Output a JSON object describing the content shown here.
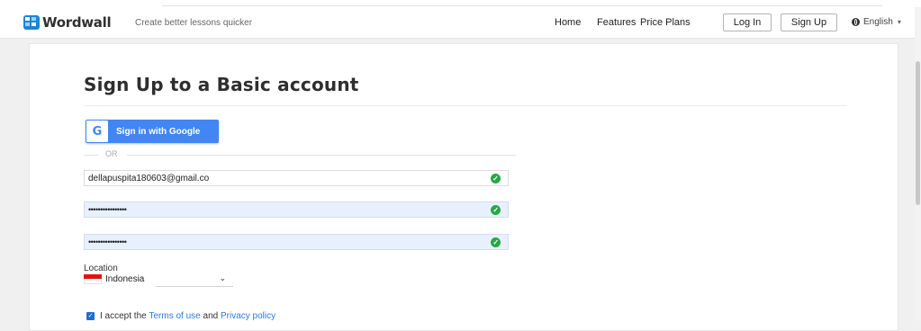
{
  "header": {
    "logo_text": "Wordwall",
    "tagline": "Create better lessons quicker",
    "nav": [
      "Home",
      "Features",
      "Price Plans"
    ],
    "login_label": "Log In",
    "signup_label": "Sign Up",
    "language": "English"
  },
  "page": {
    "title": "Sign Up to a Basic account"
  },
  "form": {
    "google_label": "Sign in with Google",
    "google_letter": "G",
    "or_label": "OR",
    "email_value": "dellapuspita180603@gmail.co",
    "password_value": "••••••••••••••••",
    "confirm_value": "••••••••••••••••",
    "location_label": "Location",
    "location_value": "Indonesia",
    "accept_prefix": "I accept the",
    "terms_label": "Terms of use",
    "and_label": "and",
    "privacy_label": "Privacy policy"
  },
  "colors": {
    "brand": "#1b86d6",
    "google": "#4285f4",
    "valid": "#28a745",
    "autofill": "#e8f0fe",
    "link": "#2a7ae2"
  },
  "icons": [
    "wordwall-logo-icon",
    "globe-icon",
    "chevron-down-icon",
    "google-g-icon",
    "valid-check-icon",
    "indonesia-flag-icon",
    "checkbox-checked-icon"
  ]
}
